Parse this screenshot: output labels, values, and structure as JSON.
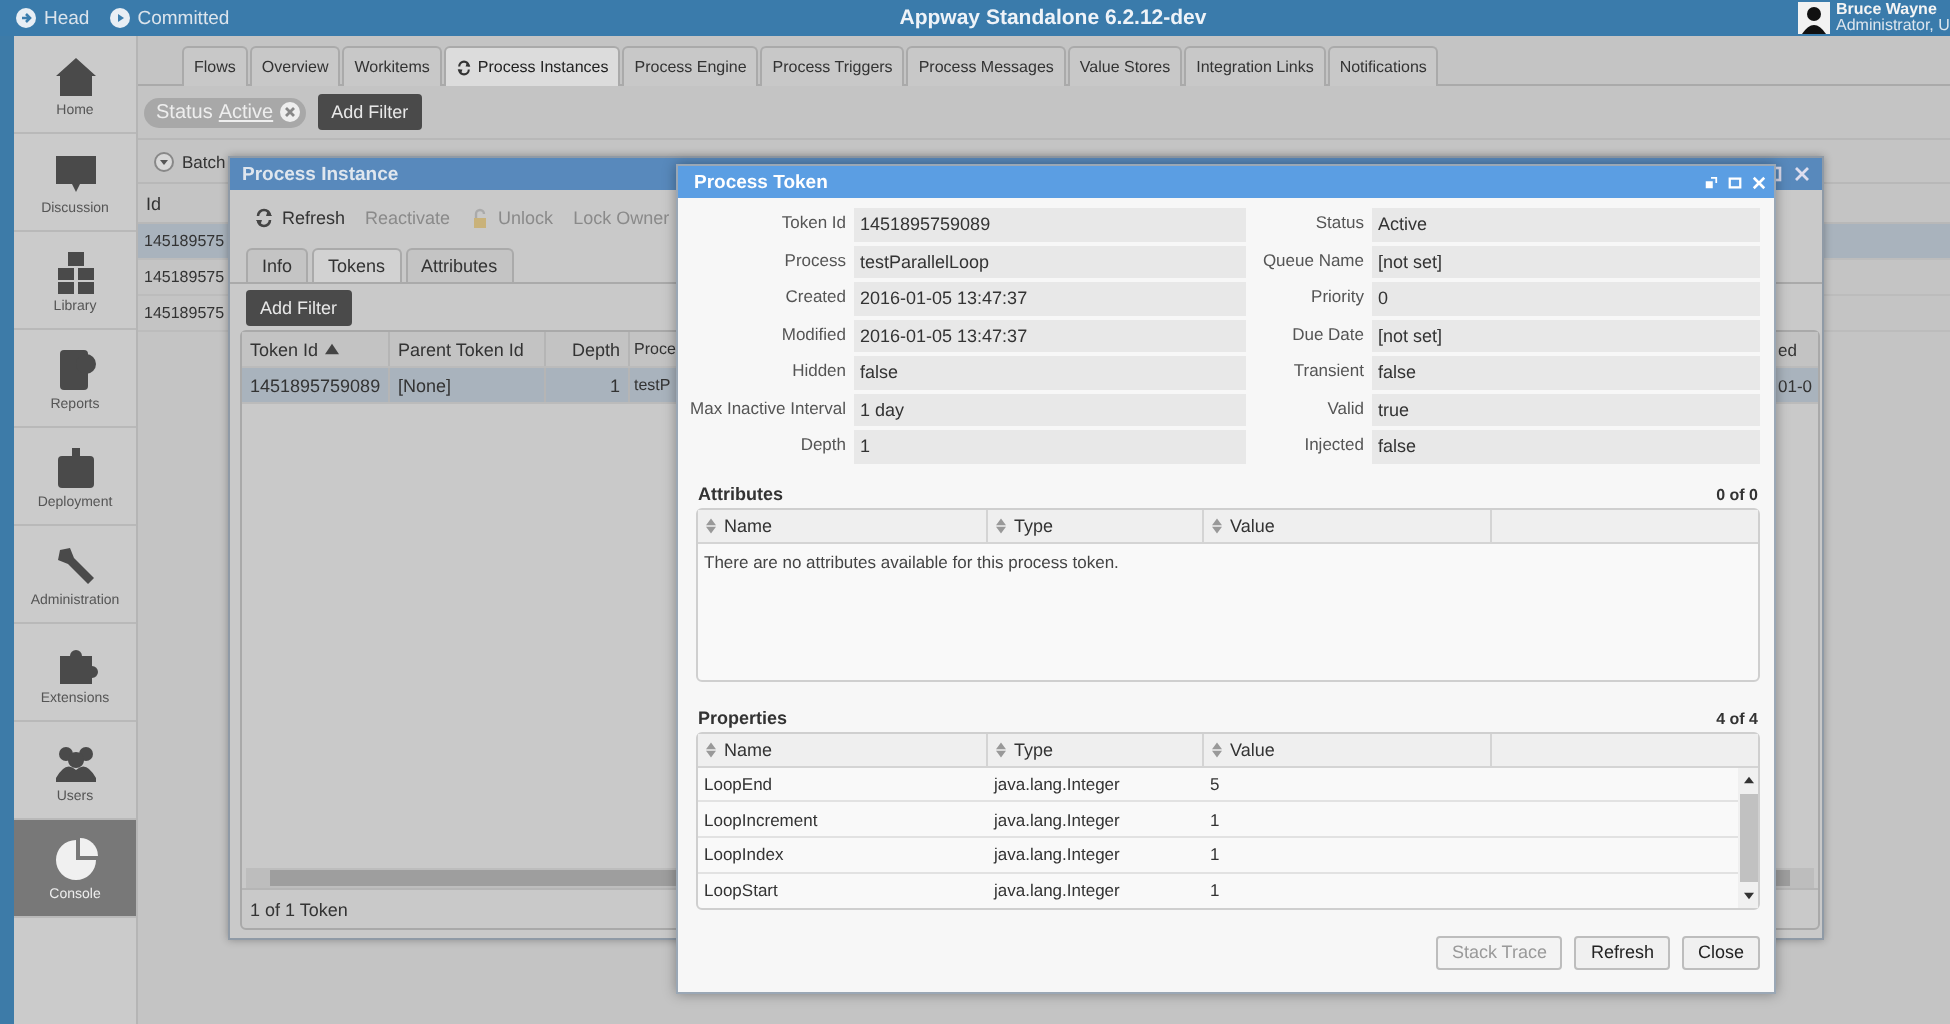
{
  "top_bar": {
    "items": [
      {
        "kind": "head",
        "label": "Head"
      },
      {
        "kind": "committed",
        "label": "Committed"
      }
    ],
    "title": "Appway Standalone 6.2.12-dev",
    "user": {
      "name": "Bruce Wayne",
      "role": "Administrator, U"
    }
  },
  "sidebar": {
    "items": [
      {
        "kind": "home",
        "label": "Home",
        "selected": false
      },
      {
        "kind": "discussion",
        "label": "Discussion",
        "selected": false
      },
      {
        "kind": "library",
        "label": "Library",
        "selected": false
      },
      {
        "kind": "reports",
        "label": "Reports",
        "selected": false
      },
      {
        "kind": "deployment",
        "label": "Deployment",
        "selected": false
      },
      {
        "kind": "administration",
        "label": "Administration",
        "selected": false
      },
      {
        "kind": "extensions",
        "label": "Extensions",
        "selected": false
      },
      {
        "kind": "users",
        "label": "Users",
        "selected": false
      },
      {
        "kind": "console",
        "label": "Console",
        "selected": true
      }
    ]
  },
  "tabs": [
    {
      "label": "Flows",
      "selected": false,
      "icon": false
    },
    {
      "label": "Overview",
      "selected": false,
      "icon": false
    },
    {
      "label": "Workitems",
      "selected": false,
      "icon": false
    },
    {
      "label": "Process Instances",
      "selected": true,
      "icon": true
    },
    {
      "label": "Process Engine",
      "selected": false,
      "icon": false
    },
    {
      "label": "Process Triggers",
      "selected": false,
      "icon": false
    },
    {
      "label": "Process Messages",
      "selected": false,
      "icon": false
    },
    {
      "label": "Value Stores",
      "selected": false,
      "icon": false
    },
    {
      "label": "Integration Links",
      "selected": false,
      "icon": false
    },
    {
      "label": "Notifications",
      "selected": false,
      "icon": false
    }
  ],
  "filters": {
    "chips": [
      {
        "field": "Status",
        "value": "Active"
      }
    ],
    "add_button": "Add Filter"
  },
  "batch": {
    "label": "Batch"
  },
  "instances_table": {
    "column": "Id",
    "rows": [
      {
        "id": "145189575",
        "selected": true
      },
      {
        "id": "145189575",
        "selected": false
      },
      {
        "id": "145189575",
        "selected": false
      }
    ]
  },
  "process_instance_dialog": {
    "title": "Process Instance",
    "toolbar": [
      {
        "kind": "refresh",
        "label": "Refresh",
        "disabled": false
      },
      {
        "kind": "plain",
        "label": "Reactivate",
        "disabled": true
      },
      {
        "kind": "lock",
        "label": "Unlock",
        "disabled": true
      },
      {
        "kind": "plain",
        "label": "Lock Owner",
        "disabled": true
      }
    ],
    "tabs": [
      {
        "label": "Info",
        "selected": false
      },
      {
        "label": "Tokens",
        "selected": true
      },
      {
        "label": "Attributes",
        "selected": false
      }
    ],
    "add_filter": "Add Filter",
    "table": {
      "columns": [
        {
          "label": "Token Id",
          "sorted": true
        },
        {
          "label": "Parent Token Id"
        },
        {
          "label": "Depth"
        },
        {
          "label": "Proce"
        },
        {
          "label": "ed"
        }
      ],
      "rows": [
        {
          "cells": [
            "1451895759089",
            "[None]",
            "1",
            "testP",
            "01-0"
          ],
          "selected": true
        }
      ],
      "footer": "1 of 1 Token"
    }
  },
  "process_token_dialog": {
    "title": "Process Token",
    "fields": [
      {
        "label": "Token Id",
        "value": "1451895759089"
      },
      {
        "label": "Status",
        "value": "Active"
      },
      {
        "label": "Process",
        "value": "testParallelLoop"
      },
      {
        "label": "Queue Name",
        "value": "[not set]"
      },
      {
        "label": "Created",
        "value": "2016-01-05 13:47:37"
      },
      {
        "label": "Priority",
        "value": "0"
      },
      {
        "label": "Modified",
        "value": "2016-01-05 13:47:37"
      },
      {
        "label": "Due Date",
        "value": "[not set]"
      },
      {
        "label": "Hidden",
        "value": "false"
      },
      {
        "label": "Transient",
        "value": "false"
      },
      {
        "label": "Max Inactive Interval",
        "value": "1 day"
      },
      {
        "label": "Valid",
        "value": "true"
      },
      {
        "label": "Depth",
        "value": "1"
      },
      {
        "label": "Injected",
        "value": "false"
      }
    ],
    "attributes": {
      "title": "Attributes",
      "count": "0 of 0",
      "columns": [
        "Name",
        "Type",
        "Value"
      ],
      "empty_message": "There are no attributes available for this process token."
    },
    "properties": {
      "title": "Properties",
      "count": "4 of 4",
      "columns": [
        "Name",
        "Type",
        "Value"
      ],
      "rows": [
        [
          "LoopEnd",
          "java.lang.Integer",
          "5"
        ],
        [
          "LoopIncrement",
          "java.lang.Integer",
          "1"
        ],
        [
          "LoopIndex",
          "java.lang.Integer",
          "1"
        ],
        [
          "LoopStart",
          "java.lang.Integer",
          "1"
        ]
      ]
    },
    "buttons": [
      {
        "label": "Stack Trace",
        "disabled": true
      },
      {
        "label": "Refresh",
        "disabled": false
      },
      {
        "label": "Close",
        "disabled": false
      }
    ]
  }
}
